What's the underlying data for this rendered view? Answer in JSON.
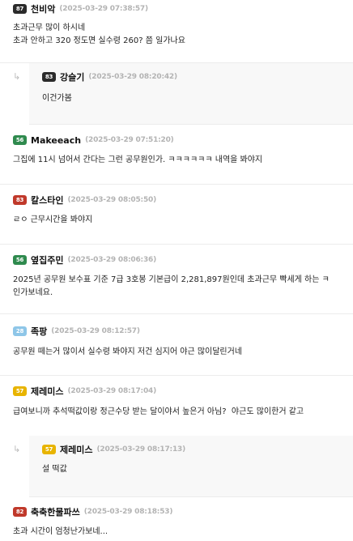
{
  "comments": [
    {
      "badge": {
        "text": "87",
        "color": "#2b2b2b"
      },
      "nick": "천비악",
      "date": "(2025-03-29 07:38:57)",
      "body": "초과근무 많이 하시네\n초과 안하고 320 정도면 실수령 260? 쯤 일가나요",
      "reply": false
    },
    {
      "badge": {
        "text": "83",
        "color": "#2b2b2b"
      },
      "nick": "강슬기",
      "date": "(2025-03-29 08:20:42)",
      "body": "이건가봄",
      "reply": true
    },
    {
      "badge": {
        "text": "56",
        "color": "#2f8a4e"
      },
      "nick": "Makeeach",
      "date": "(2025-03-29 07:51:20)",
      "body": "그집에 11시 넘어서 간다는 그런 공무원인가. ㅋㅋㅋㅋㅋㅋ 내역을 봐야지",
      "reply": false
    },
    {
      "badge": {
        "text": "83",
        "color": "#c0392b"
      },
      "nick": "칼스타인",
      "date": "(2025-03-29 08:05:50)",
      "body": "ㄹㅇ 근무시간을 봐야지",
      "reply": false
    },
    {
      "badge": {
        "text": "56",
        "color": "#2f8a4e"
      },
      "nick": "옆집주민",
      "date": "(2025-03-29 08:06:36)",
      "body": "2025년 공무원 보수표 기준 7급 3호봉 기본급이 2,281,897원인데 초과근무 빡세게 하는 ㅋ\n인가보네요.",
      "reply": false
    },
    {
      "badge": {
        "text": "28",
        "color": "#8ec6e8"
      },
      "nick": "족팡",
      "date": "(2025-03-29 08:12:57)",
      "body": "공무원 떼는거 많이서 실수령 봐야지 저건 심지어 야근 많이달린거네",
      "reply": false
    },
    {
      "badge": {
        "text": "57",
        "color": "#e8b400"
      },
      "nick": "제레미스",
      "date": "(2025-03-29 08:17:04)",
      "body": "급여보니까 추석떡값이랑 정근수당 받는 달이야서 높은거 아님?  야근도 많이한거 같고",
      "reply": false
    },
    {
      "badge": {
        "text": "57",
        "color": "#e8b400"
      },
      "nick": "제레미스",
      "date": "(2025-03-29 08:17:13)",
      "body": "설 떡값",
      "reply": true
    },
    {
      "badge": {
        "text": "82",
        "color": "#c0392b"
      },
      "nick": "축축한물파쓰",
      "date": "(2025-03-29 08:18:53)",
      "body": "초과 시간이 엄청난가보네...",
      "reply": false
    }
  ],
  "reply_arrow": "↳"
}
